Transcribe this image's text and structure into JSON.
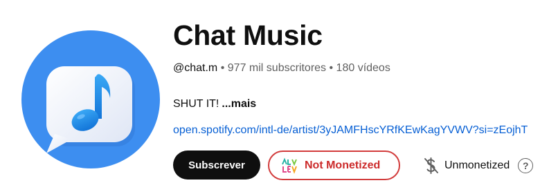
{
  "channel": {
    "name": "Chat Music",
    "handle": "@chat.m",
    "subscribers": "977 mil subscritores",
    "videos": "180 vídeos",
    "separator": "•",
    "description": "SHUT IT!",
    "more_label": "...mais",
    "link": "open.spotify.com/intl-de/artist/3yJAMFHscYRfKEwKagYVWV?si=zEojhT"
  },
  "actions": {
    "subscribe_label": "Subscrever",
    "monetization_label": "Not Monetized",
    "status_label": "Unmonetized",
    "help_glyph": "?"
  },
  "icons": {
    "avatar": "music-note-chat-bubble-icon",
    "monetization_logo": "nexlev-logo-icon",
    "status": "dollar-off-icon",
    "help": "question-circle-icon"
  },
  "colors": {
    "avatar_bg": "#3d8ef0",
    "music_note": "#1f8fe6",
    "subscribe_bg": "#0f0f0f",
    "not_monetized": "#d23b3b",
    "link": "#065fd4"
  }
}
